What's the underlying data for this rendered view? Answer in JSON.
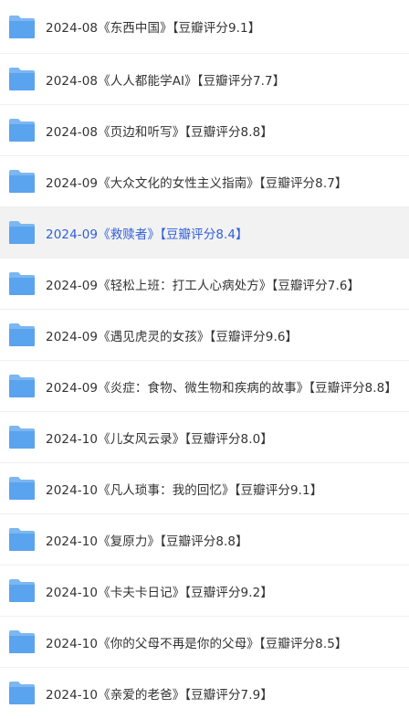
{
  "colors": {
    "text": "#333333",
    "selected_text": "#2f5fd9",
    "selected_bg": "#f2f2f2",
    "folder_body": "#7cb7f1",
    "folder_front": "#5aa3ee"
  },
  "icon": "folder-icon",
  "items": [
    {
      "name": "2024-08《东西中国》【豆瓣评分9.1】"
    },
    {
      "name": "2024-08《人人都能学AI》【豆瓣评分7.7】"
    },
    {
      "name": "2024-08《页边和听写》【豆瓣评分8.8】"
    },
    {
      "name": "2024-09《大众文化的女性主义指南》【豆瓣评分8.7】"
    },
    {
      "name": "2024-09《救赎者》【豆瓣评分8.4】",
      "selected": true
    },
    {
      "name": "2024-09《轻松上班：打工人心病处方》【豆瓣评分7.6】"
    },
    {
      "name": "2024-09《遇见虎灵的女孩》【豆瓣评分9.6】"
    },
    {
      "name": "2024-09《炎症：食物、微生物和疾病的故事》【豆瓣评分8.8】"
    },
    {
      "name": "2024-10《儿女风云录》【豆瓣评分8.0】"
    },
    {
      "name": "2024-10《凡人琐事：我的回忆》【豆瓣评分9.1】"
    },
    {
      "name": "2024-10《复原力》【豆瓣评分8.8】"
    },
    {
      "name": "2024-10《卡夫卡日记》【豆瓣评分9.2】"
    },
    {
      "name": "2024-10《你的父母不再是你的父母》【豆瓣评分8.5】"
    },
    {
      "name": "2024-10《亲爱的老爸》【豆瓣评分7.9】"
    }
  ]
}
